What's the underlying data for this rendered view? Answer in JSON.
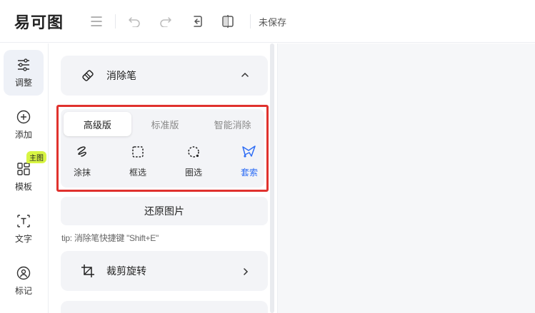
{
  "app": {
    "logo_text": "易可图",
    "status": "未保存"
  },
  "toolbar": {
    "items": [
      {
        "name": "menu",
        "icon": "menu-icon"
      },
      {
        "name": "undo",
        "icon": "undo-icon"
      },
      {
        "name": "redo",
        "icon": "redo-icon"
      },
      {
        "name": "reset",
        "icon": "reset-icon"
      },
      {
        "name": "compare",
        "icon": "compare-icon"
      }
    ]
  },
  "rail": {
    "items": [
      {
        "label": "调整",
        "icon": "sliders-icon",
        "active": true
      },
      {
        "label": "添加",
        "icon": "plus-circle-icon"
      },
      {
        "label": "模板",
        "icon": "template-grid-icon",
        "badge": "主图"
      },
      {
        "label": "文字",
        "icon": "text-icon"
      },
      {
        "label": "标记",
        "icon": "marker-icon"
      }
    ]
  },
  "eraser_card": {
    "title": "消除笔",
    "icon": "eraser-icon",
    "expanded": true
  },
  "eraser_tabs": [
    "高级版",
    "标准版",
    "智能消除"
  ],
  "eraser_active_tab": "高级版",
  "eraser_tools": [
    {
      "label": "涂抹",
      "icon": "brush-icon"
    },
    {
      "label": "框选",
      "icon": "rect-select-icon"
    },
    {
      "label": "圈选",
      "icon": "circle-select-icon"
    },
    {
      "label": "套索",
      "icon": "lasso-icon",
      "active": true
    }
  ],
  "restore_button": "还原图片",
  "tip": {
    "prefix": "tip:",
    "text": " 消除笔快捷键 \"Shift+E\""
  },
  "crop_card": {
    "title": "裁剪旋转",
    "icon": "crop-icon"
  },
  "colors": {
    "accent": "#2e6df5",
    "highlight_border": "#e0322e",
    "badge": "#d8f543"
  }
}
